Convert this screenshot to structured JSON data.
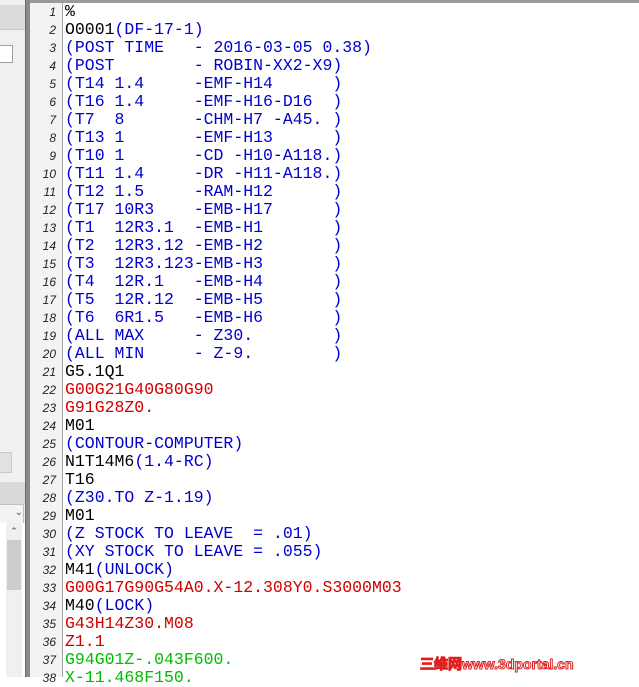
{
  "colors": {
    "black": "#000000",
    "blue": "#0000d0",
    "red": "#d00000",
    "green": "#00bb00"
  },
  "left_panel": {
    "dropdown_icon": "chevron-down-icon",
    "scroll_up_icon": "chevron-up-icon"
  },
  "lines": [
    {
      "n": "1",
      "parts": [
        {
          "t": "%",
          "c": "black"
        }
      ]
    },
    {
      "n": "2",
      "parts": [
        {
          "t": "O0001",
          "c": "black"
        },
        {
          "t": "(DF-17-1)",
          "c": "blue"
        }
      ]
    },
    {
      "n": "3",
      "parts": [
        {
          "t": "(POST TIME   - 2016-03-05 0.38)",
          "c": "blue"
        }
      ]
    },
    {
      "n": "4",
      "parts": [
        {
          "t": "(POST        - ROBIN-XX2-X9)",
          "c": "blue"
        }
      ]
    },
    {
      "n": "5",
      "parts": [
        {
          "t": "(T14 1.4     -EMF-H14      )",
          "c": "blue"
        }
      ]
    },
    {
      "n": "6",
      "parts": [
        {
          "t": "(T16 1.4     -EMF-H16-D16  )",
          "c": "blue"
        }
      ]
    },
    {
      "n": "7",
      "parts": [
        {
          "t": "(T7  8       -CHM-H7 -A45. )",
          "c": "blue"
        }
      ]
    },
    {
      "n": "8",
      "parts": [
        {
          "t": "(T13 1       -EMF-H13      )",
          "c": "blue"
        }
      ]
    },
    {
      "n": "9",
      "parts": [
        {
          "t": "(T10 1       -CD -H10-A118.)",
          "c": "blue"
        }
      ]
    },
    {
      "n": "10",
      "parts": [
        {
          "t": "(T11 1.4     -DR -H11-A118.)",
          "c": "blue"
        }
      ]
    },
    {
      "n": "11",
      "parts": [
        {
          "t": "(T12 1.5     -RAM-H12      )",
          "c": "blue"
        }
      ]
    },
    {
      "n": "12",
      "parts": [
        {
          "t": "(T17 10R3    -EMB-H17      )",
          "c": "blue"
        }
      ]
    },
    {
      "n": "13",
      "parts": [
        {
          "t": "(T1  12R3.1  -EMB-H1       )",
          "c": "blue"
        }
      ]
    },
    {
      "n": "14",
      "parts": [
        {
          "t": "(T2  12R3.12 -EMB-H2       )",
          "c": "blue"
        }
      ]
    },
    {
      "n": "15",
      "parts": [
        {
          "t": "(T3  12R3.123-EMB-H3       )",
          "c": "blue"
        }
      ]
    },
    {
      "n": "16",
      "parts": [
        {
          "t": "(T4  12R.1   -EMB-H4       )",
          "c": "blue"
        }
      ]
    },
    {
      "n": "17",
      "parts": [
        {
          "t": "(T5  12R.12  -EMB-H5       )",
          "c": "blue"
        }
      ]
    },
    {
      "n": "18",
      "parts": [
        {
          "t": "(T6  6R1.5   -EMB-H6       )",
          "c": "blue"
        }
      ]
    },
    {
      "n": "19",
      "parts": [
        {
          "t": "(ALL MAX     - Z30.        )",
          "c": "blue"
        }
      ]
    },
    {
      "n": "20",
      "parts": [
        {
          "t": "(ALL MIN     - Z-9.        )",
          "c": "blue"
        }
      ]
    },
    {
      "n": "21",
      "parts": [
        {
          "t": "G5.1Q1",
          "c": "black"
        }
      ]
    },
    {
      "n": "22",
      "parts": [
        {
          "t": "G00G21G40G80G90",
          "c": "red"
        }
      ]
    },
    {
      "n": "23",
      "parts": [
        {
          "t": "G91G28Z0.",
          "c": "red"
        }
      ]
    },
    {
      "n": "24",
      "parts": [
        {
          "t": "M01",
          "c": "black"
        }
      ]
    },
    {
      "n": "25",
      "parts": [
        {
          "t": "(CONTOUR-COMPUTER)",
          "c": "blue"
        }
      ]
    },
    {
      "n": "26",
      "parts": [
        {
          "t": "N1T14M6",
          "c": "black"
        },
        {
          "t": "(1.4-RC)",
          "c": "blue"
        }
      ]
    },
    {
      "n": "27",
      "parts": [
        {
          "t": "T16",
          "c": "black"
        }
      ]
    },
    {
      "n": "28",
      "parts": [
        {
          "t": "(Z30.TO Z-1.19)",
          "c": "blue"
        }
      ]
    },
    {
      "n": "29",
      "parts": [
        {
          "t": "M01",
          "c": "black"
        }
      ]
    },
    {
      "n": "30",
      "parts": [
        {
          "t": "(Z STOCK TO LEAVE  = .01)",
          "c": "blue"
        }
      ]
    },
    {
      "n": "31",
      "parts": [
        {
          "t": "(XY STOCK TO LEAVE = .055)",
          "c": "blue"
        }
      ]
    },
    {
      "n": "32",
      "parts": [
        {
          "t": "M41",
          "c": "black"
        },
        {
          "t": "(UNLOCK)",
          "c": "blue"
        }
      ]
    },
    {
      "n": "33",
      "parts": [
        {
          "t": "G00G17G90G54A0.X-12.308Y0.S3000M03",
          "c": "red"
        }
      ]
    },
    {
      "n": "34",
      "parts": [
        {
          "t": "M40",
          "c": "black"
        },
        {
          "t": "(LOCK)",
          "c": "blue"
        }
      ]
    },
    {
      "n": "35",
      "parts": [
        {
          "t": "G43H14Z30.M08",
          "c": "red"
        }
      ]
    },
    {
      "n": "36",
      "parts": [
        {
          "t": "Z1.1",
          "c": "red"
        }
      ]
    },
    {
      "n": "37",
      "parts": [
        {
          "t": "G94G01Z-.043F600.",
          "c": "green"
        }
      ]
    },
    {
      "n": "38",
      "parts": [
        {
          "t": "X-11.468F150.",
          "c": "green"
        }
      ]
    }
  ],
  "watermark": "三维网www.3dportal.cn"
}
